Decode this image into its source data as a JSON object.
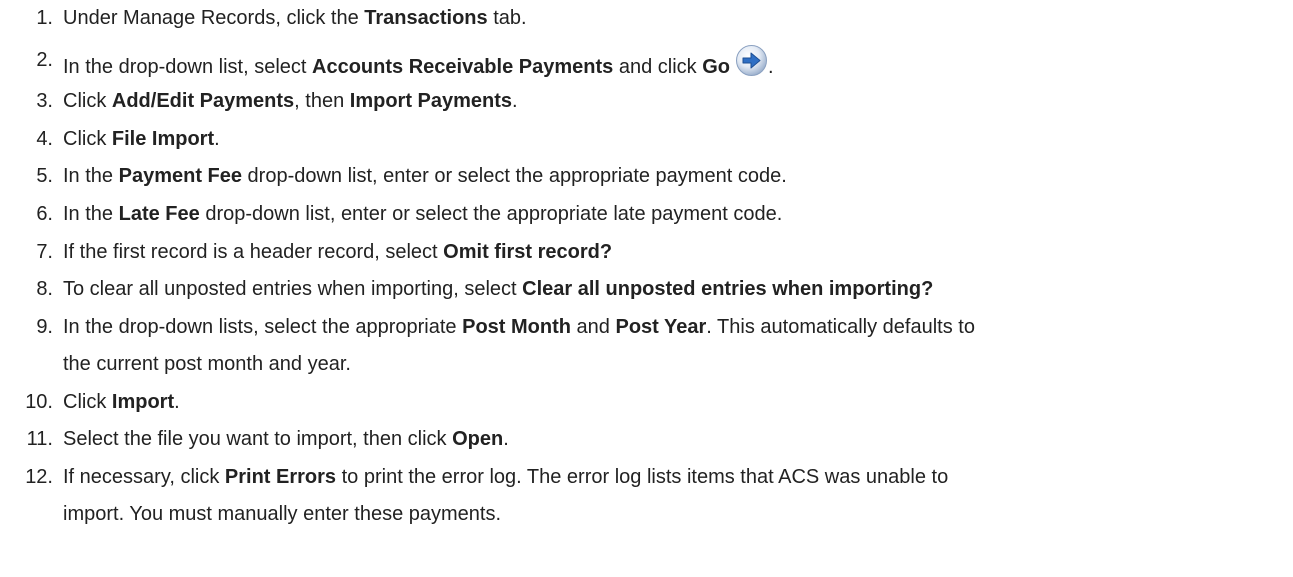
{
  "steps": [
    {
      "n": "1.",
      "parts": [
        "Under Manage Records, click the ",
        "Transactions",
        " tab."
      ]
    },
    {
      "n": "2.",
      "parts": [
        "In the drop-down list, select ",
        "Accounts Receivable Payments",
        " and click ",
        "Go",
        "."
      ],
      "icon": "go-arrow-icon"
    },
    {
      "n": "3.",
      "parts": [
        "Click ",
        "Add/Edit Payments",
        ", then ",
        "Import Payments",
        "."
      ]
    },
    {
      "n": "4.",
      "parts": [
        "Click ",
        "File Import",
        "."
      ]
    },
    {
      "n": "5.",
      "parts": [
        "In the ",
        "Payment Fee",
        " drop-down list, enter or select the appropriate payment code."
      ]
    },
    {
      "n": "6.",
      "parts": [
        "In the ",
        "Late Fee",
        " drop-down list, enter or select the appropriate late payment code."
      ]
    },
    {
      "n": "7.",
      "parts": [
        "If the first record is a header record, select ",
        "Omit first record?"
      ]
    },
    {
      "n": "8.",
      "parts": [
        "To clear all unposted entries when importing, select ",
        "Clear all unposted entries when importing?"
      ]
    },
    {
      "n": "9.",
      "parts": [
        "In the drop-down lists, select the appropriate ",
        "Post Month",
        " and ",
        "Post Year",
        ". This automatically defaults to"
      ],
      "cont": "the current post month and year."
    },
    {
      "n": "10.",
      "parts": [
        "Click ",
        "Import",
        "."
      ]
    },
    {
      "n": "11.",
      "parts": [
        "Select the file you want to import, then click ",
        "Open",
        "."
      ]
    },
    {
      "n": "12.",
      "parts": [
        "If necessary, click ",
        "Print Errors",
        " to print the error log. The error log lists items that ACS was unable to"
      ],
      "cont": "import. You must manually enter these payments."
    }
  ],
  "colors": {
    "text": "#222222",
    "icon_blue": "#2f6fc4"
  }
}
